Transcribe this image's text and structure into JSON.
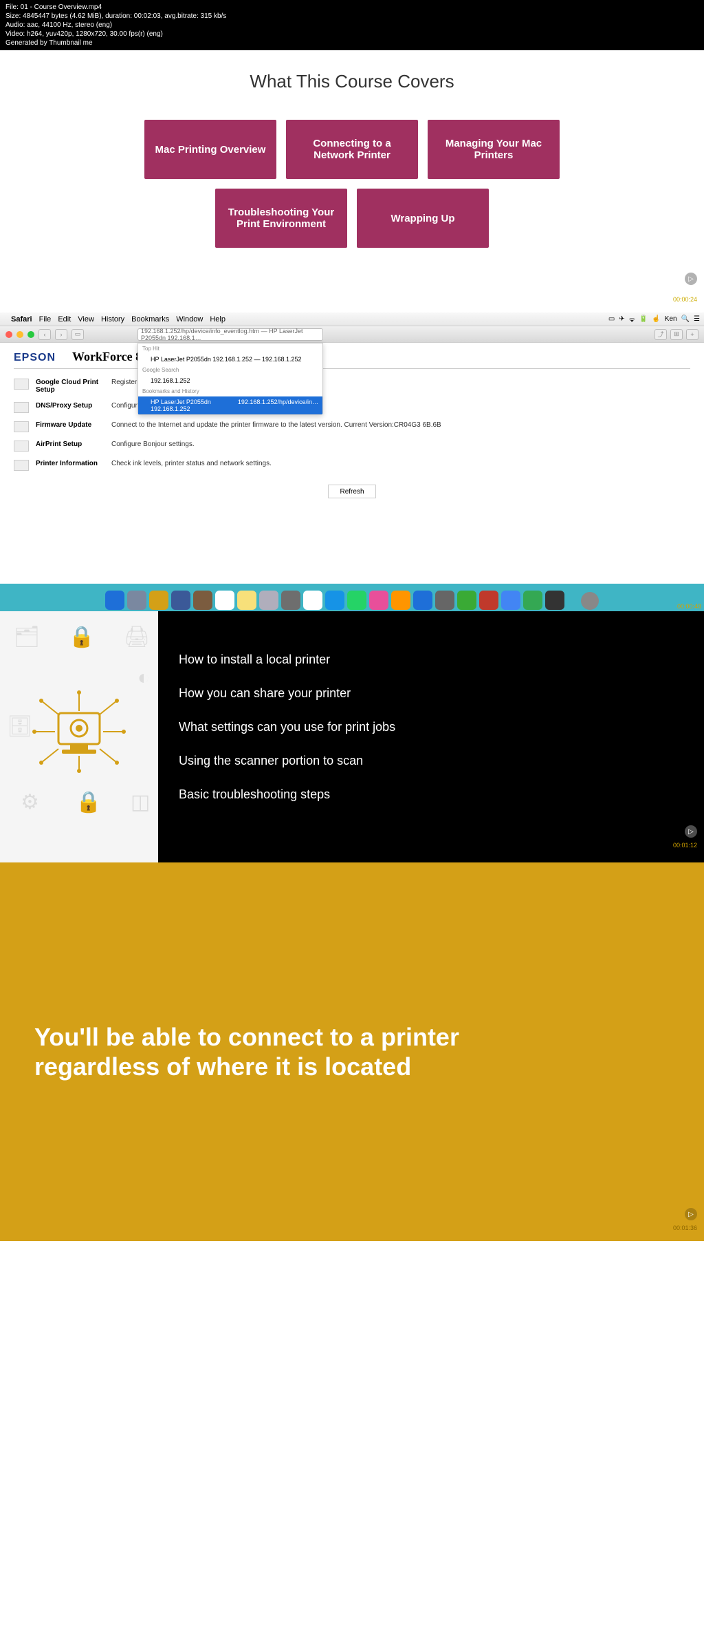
{
  "header": {
    "file": "File: 01 - Course Overview.mp4",
    "size": "Size: 4845447 bytes (4.62 MiB), duration: 00:02:03, avg.bitrate: 315 kb/s",
    "audio": "Audio: aac, 44100 Hz, stereo (eng)",
    "video": "Video: h264, yuv420p, 1280x720, 30.00 fps(r) (eng)",
    "gen": "Generated by Thumbnail me"
  },
  "section1": {
    "title": "What This Course Covers",
    "t1": "Mac Printing Overview",
    "t2": "Connecting to a Network Printer",
    "t3": "Managing Your Mac Printers",
    "t4": "Troubleshooting Your Print Environment",
    "t5": "Wrapping Up",
    "ts": "00:00:24"
  },
  "section2": {
    "menu": {
      "app": "Safari",
      "m1": "File",
      "m2": "Edit",
      "m3": "View",
      "m4": "History",
      "m5": "Bookmarks",
      "m6": "Window",
      "m7": "Help",
      "user": "Ken"
    },
    "url": "192.168.1.252/hp/device/info_eventlog.htm — HP LaserJet P2055dn  192.168.1…",
    "dd": {
      "l1": "Top Hit",
      "i1": "HP LaserJet P2055dn  192.168.1.252 — 192.168.1.252",
      "l2": "Google Search",
      "i2": "192.168.1.252",
      "l3": "Bookmarks and History",
      "i3a": "HP LaserJet P2055dn  192.168.1.252",
      "i3b": "192.168.1.252/hp/device/in…"
    },
    "epson": {
      "logo": "EPSON",
      "model": "WorkForce 845",
      "r1n": "Google Cloud Print Setup",
      "r1d": "Register or Cloud Print [Unregist",
      "r2n": "DNS/Proxy Setup",
      "r2d": "Configure DNS/Proxy settings.",
      "r3n": "Firmware Update",
      "r3d": "Connect to the Internet and update the printer firmware to the latest version. Current Version:CR04G3 6B.6B",
      "r4n": "AirPrint Setup",
      "r4d": "Configure Bonjour settings.",
      "r5n": "Printer Information",
      "r5d": "Check ink levels, printer status and network settings.",
      "refresh": "Refresh"
    },
    "ts": "00:00:48"
  },
  "section3": {
    "i1": "How to install a local printer",
    "i2": "How you can share your printer",
    "i3": "What settings can you use for print jobs",
    "i4": "Using the scanner portion to scan",
    "i5": "Basic troubleshooting steps",
    "ts": "00:01:12"
  },
  "section4": {
    "text": "You'll be able to connect to a printer regardless of where it is located",
    "ts": "00:01:36"
  }
}
